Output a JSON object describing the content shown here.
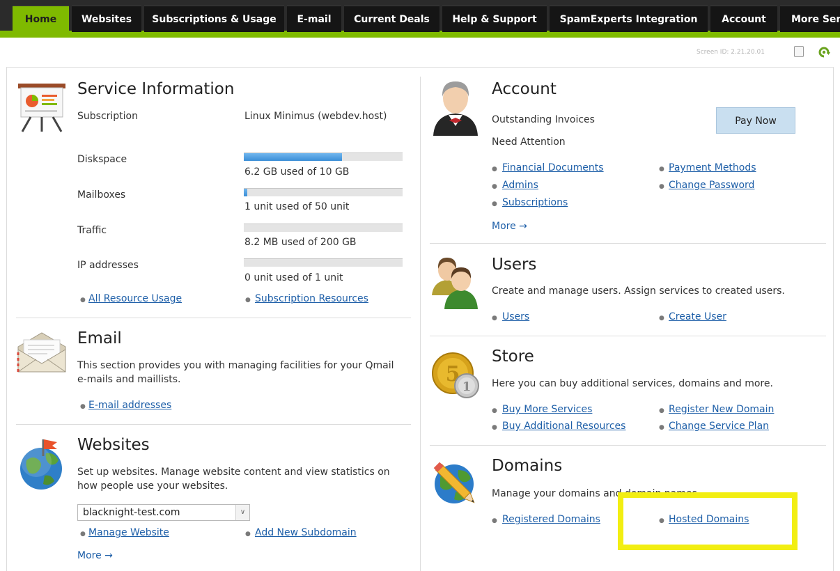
{
  "nav": {
    "tabs": [
      {
        "label": "Home",
        "active": true
      },
      {
        "label": "Websites",
        "active": false
      },
      {
        "label": "Subscriptions & Usage",
        "active": false
      },
      {
        "label": "E-mail",
        "active": false
      },
      {
        "label": "Current Deals",
        "active": false
      },
      {
        "label": "Help & Support",
        "active": false
      },
      {
        "label": "SpamExperts Integration",
        "active": false
      },
      {
        "label": "Account",
        "active": false
      },
      {
        "label": "More Ser",
        "active": false
      }
    ],
    "accent_color": "#7fba00",
    "bar_color": "#151515"
  },
  "screen_id": "Screen ID:  2.21.20.01",
  "service": {
    "title": "Service Information",
    "rows": [
      {
        "label": "Subscription",
        "value": "Linux Minimus (webdev.host)"
      },
      {
        "label": "Diskspace",
        "value": "6.2 GB used of 10 GB",
        "usage_fraction": 0.62
      },
      {
        "label": "Mailboxes",
        "value": "1 unit used of 50 unit",
        "usage_fraction": 0.02
      },
      {
        "label": "Traffic",
        "value": "8.2 MB used of 200 GB",
        "usage_fraction": 0.0
      },
      {
        "label": "IP addresses",
        "value": "0 unit used of 1 unit",
        "usage_fraction": 0.0
      }
    ],
    "links": [
      "All Resource Usage",
      "Subscription Resources"
    ],
    "icon": "presentation-board-icon"
  },
  "email": {
    "title": "Email",
    "description": "This section provides you with managing facilities for your Qmail e-mails and maillists.",
    "links": [
      "E-mail addresses"
    ],
    "icon": "envelope-icon"
  },
  "websites": {
    "title": "Websites",
    "description": "Set up websites. Manage website content and view statistics on how people use your websites.",
    "select_value": "blacknight-test.com",
    "links": [
      "Manage Website",
      "Add New Subdomain"
    ],
    "more": "More →",
    "icon": "globe-flag-icon"
  },
  "account": {
    "title": "Account",
    "outstanding_label": "Outstanding Invoices",
    "pay_button": "Pay Now",
    "attention_label": "Need Attention",
    "links_left": [
      "Financial Documents",
      "Admins",
      "Subscriptions"
    ],
    "links_right": [
      "Payment Methods",
      "Change Password"
    ],
    "more": "More →",
    "icon": "butler-icon"
  },
  "users": {
    "title": "Users",
    "description": "Create and manage users. Assign services to created users.",
    "links": [
      "Users",
      "Create User"
    ],
    "icon": "users-icon"
  },
  "store": {
    "title": "Store",
    "description": "Here you can buy additional services, domains and more.",
    "links_left": [
      "Buy More Services",
      "Buy Additional Resources"
    ],
    "links_right": [
      "Register New Domain",
      "Change Service Plan"
    ],
    "icon": "coins-icon"
  },
  "domains": {
    "title": "Domains",
    "description": "Manage your domains and domain names.",
    "links": [
      "Registered Domains",
      "Hosted Domains"
    ],
    "icon": "globe-pencil-icon",
    "highlight_color": "#f2ee12"
  }
}
